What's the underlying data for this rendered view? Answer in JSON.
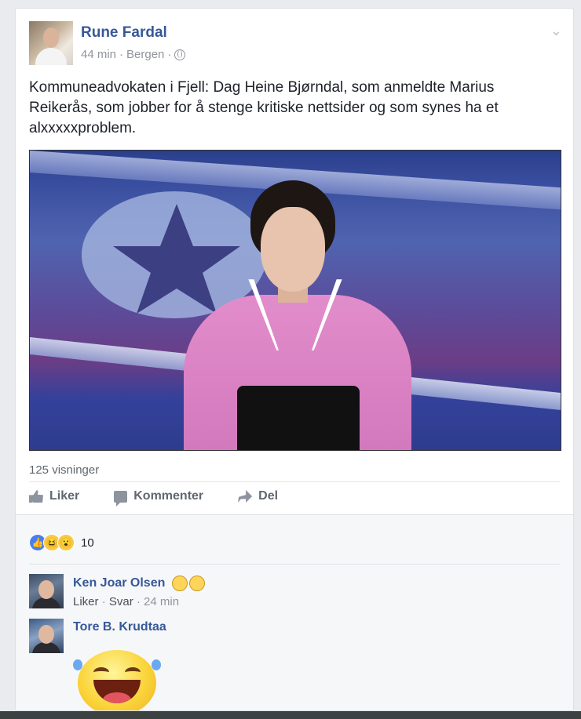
{
  "post": {
    "author": "Rune Fardal",
    "time": "44 min",
    "location": "Bergen",
    "text": "Kommuneadvokaten i Fjell: Dag Heine Bjørndal, som anmeldte Marius Reikerås, som jobber for å stenge kritiske nettsider og som synes ha et alxxxxxproblem.",
    "views": "125 visninger"
  },
  "actions": {
    "like": "Liker",
    "comment": "Kommenter",
    "share": "Del"
  },
  "reactions": {
    "count": "10"
  },
  "comments": [
    {
      "name": "Ken Joar Olsen",
      "like": "Liker",
      "reply": "Svar",
      "time": "24 min"
    },
    {
      "name": "Tore B. Krudtaa"
    }
  ],
  "icons": [
    "globe-icon",
    "chevron-down-icon",
    "like-icon",
    "comment-icon",
    "share-icon"
  ]
}
